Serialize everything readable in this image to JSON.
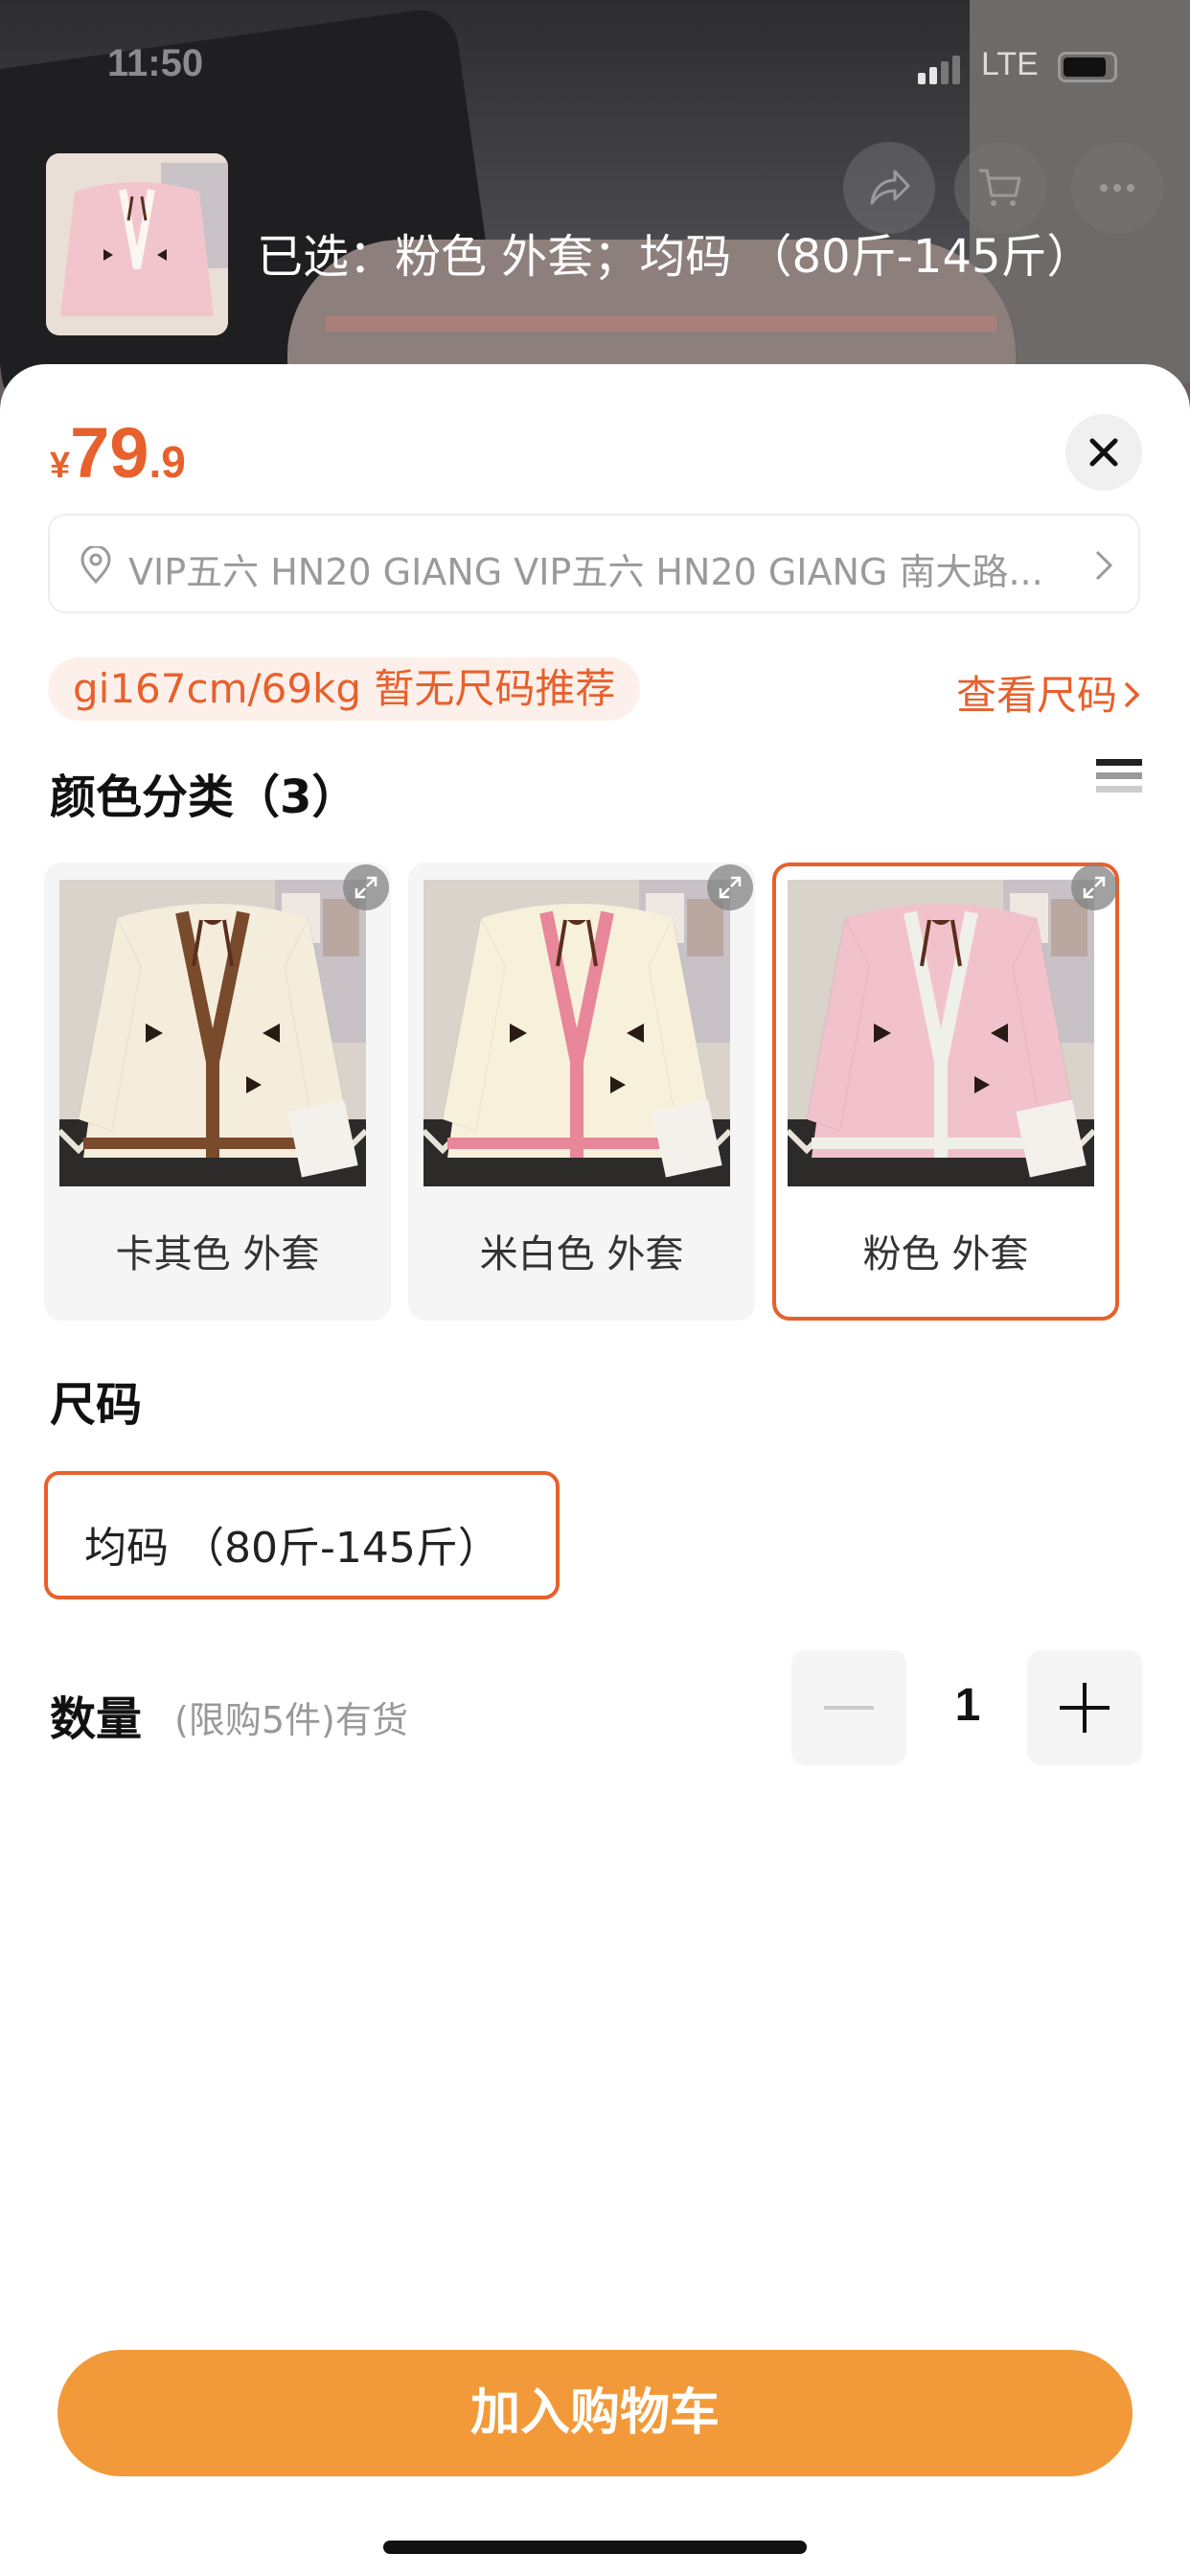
{
  "status_bar": {
    "time": "11:50",
    "network": "LTE"
  },
  "header": {
    "selected_text": "已选：粉色 外套；均码 （80斤-145斤）",
    "share_icon": "share-icon",
    "cart_icon": "cart-icon",
    "more_icon": "more-icon"
  },
  "price": {
    "symbol": "¥",
    "integer": "79",
    "decimal": ".9",
    "color": "#e8602c"
  },
  "address": {
    "text": "VIP五六 HN20 GIANG VIP五六 HN20 GIANG 南大路..."
  },
  "size_recommendation": {
    "text": "gi167cm/69kg 暂无尺码推荐",
    "size_chart_label": "查看尺码"
  },
  "color_section": {
    "title": "颜色分类（3）",
    "options": [
      {
        "label": "卡其色 外套",
        "selected": false,
        "trim_color": "#7a4a2c",
        "knit_color": "#f4eddc"
      },
      {
        "label": "米白色 外套",
        "selected": false,
        "trim_color": "#e8869a",
        "knit_color": "#f7f1dc"
      },
      {
        "label": "粉色 外套",
        "selected": true,
        "trim_color": "#f0f0ea",
        "knit_color": "#f2c2cc"
      }
    ]
  },
  "size_section": {
    "title": "尺码",
    "options": [
      {
        "label": "均码 （80斤-145斤）",
        "selected": true
      }
    ]
  },
  "quantity": {
    "label": "数量",
    "note": "(限购5件)有货",
    "value": "1"
  },
  "add_to_cart": {
    "label": "加入购物车",
    "color": "#f29a3a"
  }
}
